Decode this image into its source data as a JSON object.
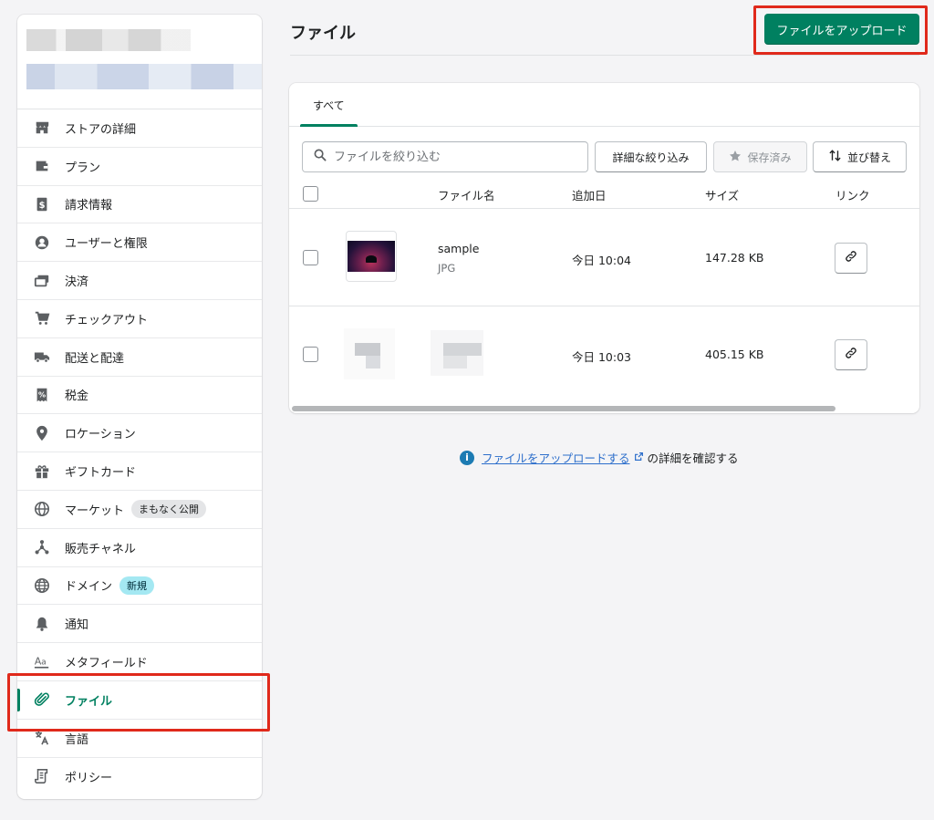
{
  "sidebar": {
    "items": [
      {
        "label": "ストアの詳細",
        "icon": "store-icon"
      },
      {
        "label": "プラン",
        "icon": "wallet-icon"
      },
      {
        "label": "請求情報",
        "icon": "billing-icon"
      },
      {
        "label": "ユーザーと権限",
        "icon": "user-icon"
      },
      {
        "label": "決済",
        "icon": "payment-icon"
      },
      {
        "label": "チェックアウト",
        "icon": "cart-icon"
      },
      {
        "label": "配送と配達",
        "icon": "truck-icon"
      },
      {
        "label": "税金",
        "icon": "tax-icon"
      },
      {
        "label": "ロケーション",
        "icon": "location-pin-icon"
      },
      {
        "label": "ギフトカード",
        "icon": "gift-icon"
      },
      {
        "label": "マーケット",
        "icon": "globe-icon",
        "badge": "まもなく公開"
      },
      {
        "label": "販売チャネル",
        "icon": "channels-icon"
      },
      {
        "label": "ドメイン",
        "icon": "domain-globe-icon",
        "badge": "新規"
      },
      {
        "label": "通知",
        "icon": "bell-icon"
      },
      {
        "label": "メタフィールド",
        "icon": "metafields-icon"
      },
      {
        "label": "ファイル",
        "icon": "paperclip-icon",
        "active": true
      },
      {
        "label": "言語",
        "icon": "translate-icon"
      },
      {
        "label": "ポリシー",
        "icon": "policy-icon"
      }
    ]
  },
  "header": {
    "title": "ファイル",
    "upload_label": "ファイルをアップロード"
  },
  "tabs": [
    {
      "label": "すべて"
    }
  ],
  "toolbar": {
    "search_placeholder": "ファイルを絞り込む",
    "filter_label": "詳細な絞り込み",
    "saved_label": "保存済み",
    "sort_label": "並び替え"
  },
  "table": {
    "columns": [
      "ファイル名",
      "追加日",
      "サイズ",
      "リンク"
    ],
    "rows": [
      {
        "name": "sample",
        "type": "JPG",
        "added": "今日 10:04",
        "size": "147.28 KB"
      },
      {
        "name": "",
        "type": "",
        "added": "今日 10:03",
        "size": "405.15 KB"
      }
    ]
  },
  "info": {
    "link_text": "ファイルをアップロードする",
    "suffix": "の詳細を確認する"
  },
  "colors": {
    "primary": "#008060",
    "highlight": "#e0291b",
    "link": "#2c6ecb"
  }
}
